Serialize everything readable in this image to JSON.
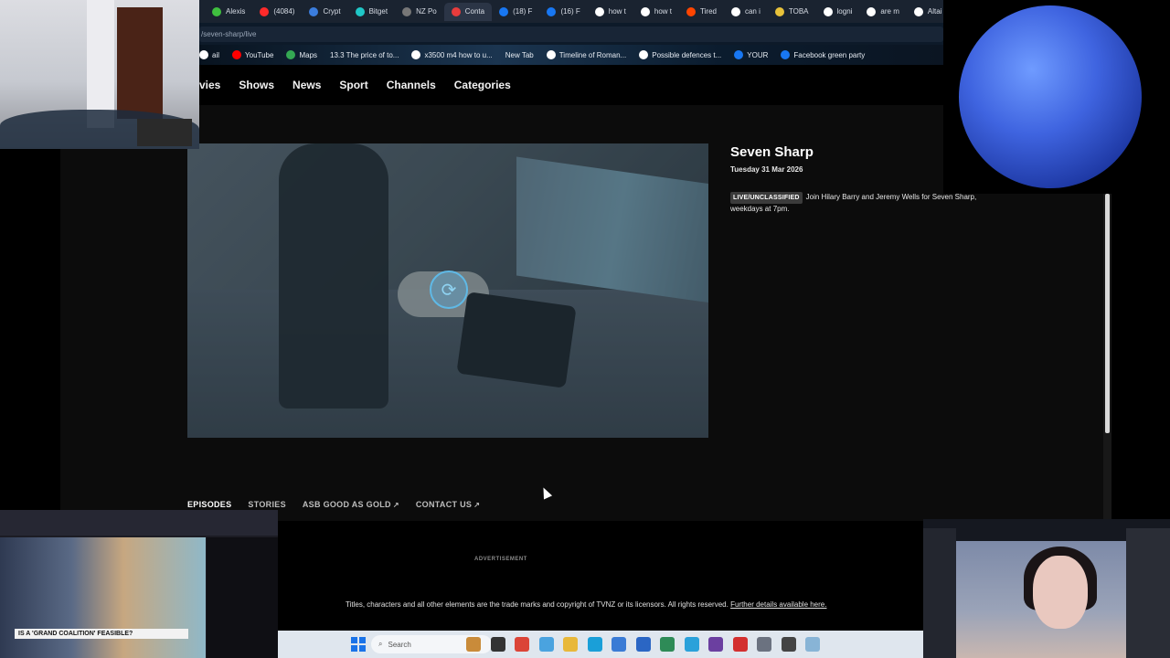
{
  "browser": {
    "tabs": [
      {
        "label": "Alexis",
        "color": "#3fbf3f"
      },
      {
        "label": "(4084)",
        "color": "#ff2a2a"
      },
      {
        "label": "Crypt",
        "color": "#3b7ddd"
      },
      {
        "label": "Bitget",
        "color": "#1fc7c7"
      },
      {
        "label": "NZ Po",
        "color": "#777777"
      },
      {
        "label": "Conta",
        "color": "#e83c3c"
      },
      {
        "label": "(18) F",
        "color": "#1877f2"
      },
      {
        "label": "(16) F",
        "color": "#1877f2"
      },
      {
        "label": "how t",
        "color": "#ffffff"
      },
      {
        "label": "how t",
        "color": "#ffffff"
      },
      {
        "label": "Tired",
        "color": "#ff4500"
      },
      {
        "label": "can i",
        "color": "#ffffff"
      },
      {
        "label": "TOBA",
        "color": "#e8c23a"
      },
      {
        "label": "logni",
        "color": "#ffffff"
      },
      {
        "label": "are m",
        "color": "#ffffff"
      },
      {
        "label": "Altai",
        "color": "#ffffff"
      }
    ],
    "new_tab_symbol": "+",
    "url": "/seven-sharp/live",
    "bookmarks": [
      {
        "label": "ail",
        "color": "#ffffff"
      },
      {
        "label": "YouTube",
        "color": "#ff0000"
      },
      {
        "label": "Maps",
        "color": "#34a853"
      },
      {
        "label": "13.3 The price of to...",
        "color": ""
      },
      {
        "label": "x3500 m4 how to u...",
        "color": "#ffffff"
      },
      {
        "label": "New Tab",
        "color": ""
      },
      {
        "label": "Timeline of Roman...",
        "color": "#ffffff"
      },
      {
        "label": "Possible defences t...",
        "color": "#ffffff"
      },
      {
        "label": "YOUR",
        "color": "#1877f2"
      },
      {
        "label": "Facebook green party",
        "color": "#1877f2"
      }
    ]
  },
  "site": {
    "nav": [
      "vies",
      "Shows",
      "News",
      "Sport",
      "Channels",
      "Categories"
    ],
    "show": {
      "title": "Seven Sharp",
      "date": "Tuesday 31 Mar 2026",
      "badge": "LIVE/UNCLASSIFIED",
      "description": "Join Hilary Barry and Jeremy Wells for Seven Sharp, weekdays at 7pm."
    },
    "player": {
      "spinner_icon": "refresh-icon",
      "spinner_glyph": "⟳"
    },
    "tabs": [
      {
        "label": "EPISODES",
        "external": false,
        "active": true
      },
      {
        "label": "STORIES",
        "external": false,
        "active": false
      },
      {
        "label": "ASB GOOD AS GOLD",
        "external": true,
        "active": false
      },
      {
        "label": "CONTACT US",
        "external": true,
        "active": false
      }
    ],
    "external_glyph": "↗",
    "advertisement": "ADVERTISEMENT",
    "legal": "Titles, characters and all other elements are the trade marks and copyright of TVNZ or its licensors. All rights reserved.",
    "legal_link": "Further details available here."
  },
  "taskbar": {
    "search_label": "Search",
    "search_icon": "search-icon",
    "apps": [
      {
        "name": "widget-icon",
        "color": "#c98b3a"
      },
      {
        "name": "file-explorer-icon",
        "color": "#333333"
      },
      {
        "name": "chrome-icon",
        "color": "#db4437"
      },
      {
        "name": "app-icon-2",
        "color": "#4aa3df"
      },
      {
        "name": "folder-icon",
        "color": "#e8b83a"
      },
      {
        "name": "edge-icon",
        "color": "#1a9fd8"
      },
      {
        "name": "app-icon-3",
        "color": "#3a7bd5"
      },
      {
        "name": "store-icon",
        "color": "#2b66c4"
      },
      {
        "name": "app-icon-4",
        "color": "#2e8b57"
      },
      {
        "name": "telegram-icon",
        "color": "#2aa1da"
      },
      {
        "name": "app-icon-5",
        "color": "#6b3fa0"
      },
      {
        "name": "app-icon-6",
        "color": "#d32f2f"
      },
      {
        "name": "settings-icon",
        "color": "#6b7280"
      },
      {
        "name": "app-icon-7",
        "color": "#444444"
      },
      {
        "name": "app-icon-8",
        "color": "#88b4d6"
      }
    ]
  },
  "overlays": {
    "news_lower_third": "IS A 'GRAND COALITION' FEASIBLE?"
  },
  "colors": {
    "accent": "#5fb9e6",
    "background": "#000000",
    "panel": "#0c0c0c"
  }
}
